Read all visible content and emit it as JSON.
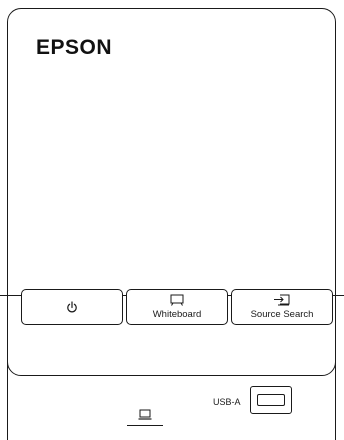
{
  "device": {
    "brand": "EPSON"
  },
  "control_panel": {
    "buttons": [
      {
        "icon": "power-icon",
        "label": ""
      },
      {
        "icon": "whiteboard-icon",
        "label": "Whiteboard"
      },
      {
        "icon": "source-search-icon",
        "label": "Source Search"
      }
    ]
  },
  "ports": {
    "usb_label": "USB-A",
    "laptop_icon": "laptop-icon"
  },
  "colors": {
    "outline": "#1a1a1a",
    "background": "#ffffff"
  }
}
